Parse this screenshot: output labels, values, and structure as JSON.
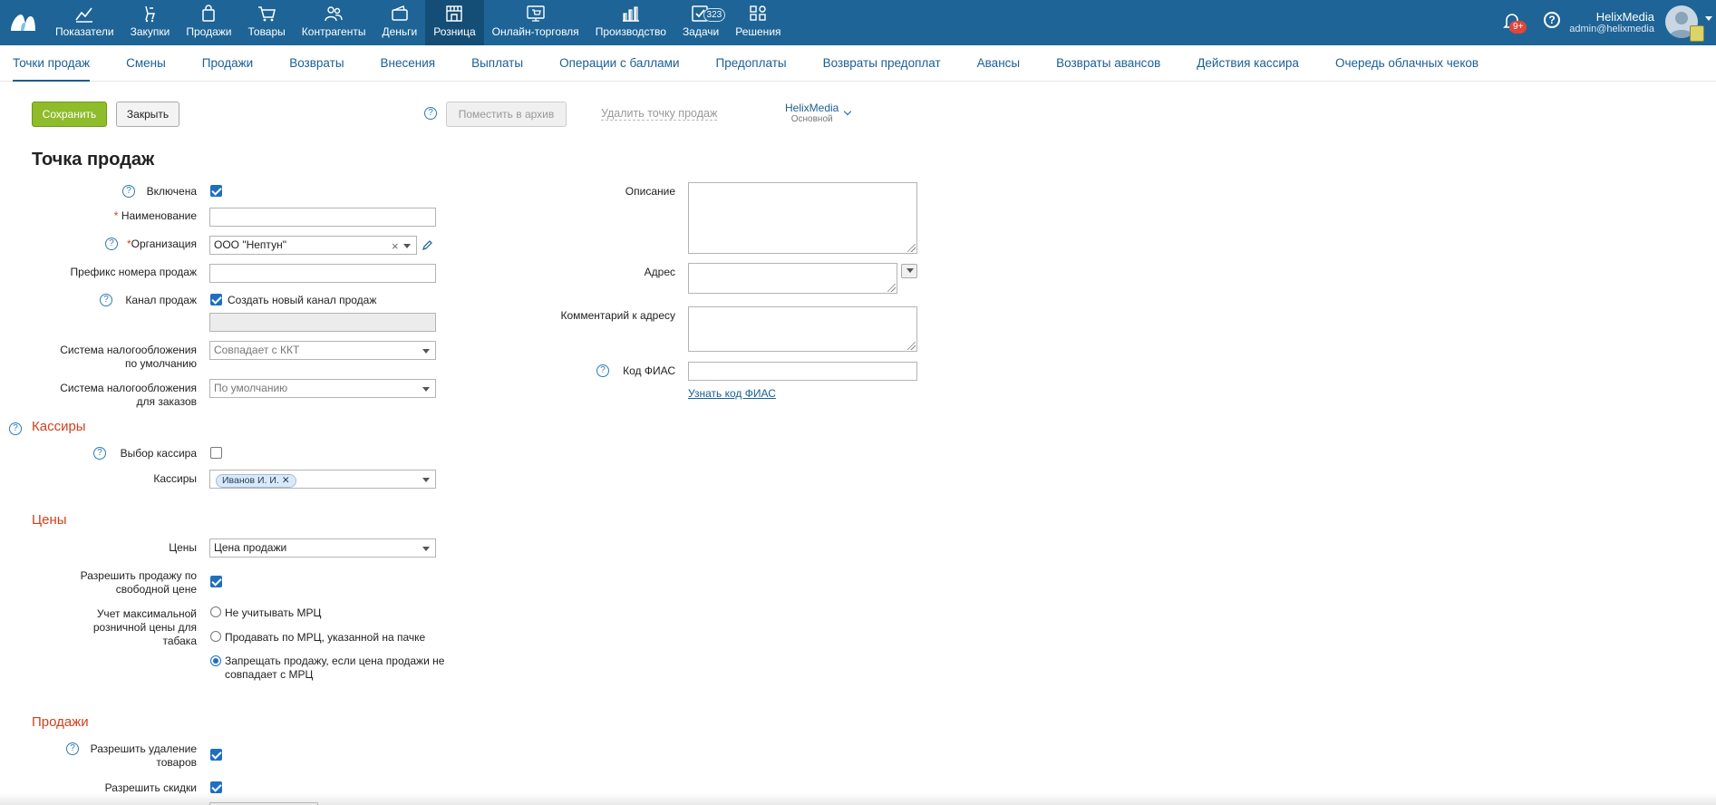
{
  "topnav": {
    "items": [
      {
        "label": "Показатели",
        "icon": "chart-line-icon"
      },
      {
        "label": "Закупки",
        "icon": "purchases-icon"
      },
      {
        "label": "Продажи",
        "icon": "shopping-bag-icon"
      },
      {
        "label": "Товары",
        "icon": "cart-icon"
      },
      {
        "label": "Контрагенты",
        "icon": "people-icon"
      },
      {
        "label": "Деньги",
        "icon": "wallet-icon"
      },
      {
        "label": "Розница",
        "icon": "store-icon"
      },
      {
        "label": "Онлайн-торговля",
        "icon": "online-store-icon"
      },
      {
        "label": "Производство",
        "icon": "production-icon"
      },
      {
        "label": "Задачи",
        "icon": "tasks-icon",
        "badge": "323"
      },
      {
        "label": "Решения",
        "icon": "apps-icon"
      }
    ],
    "active_index": 6
  },
  "user": {
    "name": "HelixMedia",
    "email": "admin@helixmedia",
    "notifications_badge": "9+",
    "help_glyph": "?"
  },
  "subnav": {
    "items": [
      "Точки продаж",
      "Смены",
      "Продажи",
      "Возвраты",
      "Внесения",
      "Выплаты",
      "Операции с баллами",
      "Предоплаты",
      "Возвраты предоплат",
      "Авансы",
      "Возвраты авансов",
      "Действия кассира",
      "Очередь облачных чеков"
    ],
    "active_index": 0
  },
  "toolbar": {
    "save": "Сохранить",
    "close": "Закрыть",
    "archive": "Поместить в архив",
    "delete": "Удалить точку продаж",
    "org_name": "HelixMedia",
    "org_sub": "Основной"
  },
  "form": {
    "title": "Точка продаж",
    "help_glyph": "?",
    "required_mark": "*",
    "enabled_label": "Включена",
    "enabled": true,
    "name_label": "Наименование",
    "name_value": "",
    "org_label": "Организация",
    "org_value": "ООО \"Нептун\"",
    "org_clear": "×",
    "prefix_label": "Префикс номера продаж",
    "prefix_value": "",
    "channel_label": "Канал продаж",
    "channel_new_label": "Создать новый канал продаж",
    "channel_new_checked": true,
    "tax_default_label_1": "Система налогообложения",
    "tax_default_label_2": "по умолчанию",
    "tax_default_value": "Совпадает с ККТ",
    "tax_orders_label_1": "Система налогообложения",
    "tax_orders_label_2": "для заказов",
    "tax_orders_value": "По умолчанию",
    "description_label": "Описание",
    "address_label": "Адрес",
    "address_comment_label": "Комментарий к адресу",
    "fias_label": "Код ФИАС",
    "fias_link": "Узнать код ФИАС"
  },
  "cashiers": {
    "section": "Кассиры",
    "choose_label": "Выбор кассира",
    "choose_checked": false,
    "list_label": "Кассиры",
    "tag": "Иванов И. И.",
    "tag_remove": "✕"
  },
  "prices": {
    "section": "Цены",
    "prices_label": "Цены",
    "prices_value": "Цена продажи",
    "free_price_label_1": "Разрешить продажу по",
    "free_price_label_2": "свободной цене",
    "free_price_checked": true,
    "mrc_label_1": "Учет максимальной",
    "mrc_label_2": "розничной цены для",
    "mrc_label_3": "табака",
    "mrc_options": [
      "Не учитывать МРЦ",
      "Продавать по МРЦ, указанной на пачке",
      "Запрещать продажу, если цена продажи не"
    ],
    "mrc_option3_line2": "совпадает с МРЦ",
    "mrc_selected": 2
  },
  "sales": {
    "section": "Продажи",
    "allow_delete_label_1": "Разрешить удаление",
    "allow_delete_label_2": "товаров",
    "allow_delete_checked": true,
    "allow_discounts_label": "Разрешить скидки",
    "allow_discounts_checked": true
  },
  "colors": {
    "topbar": "#1e6496",
    "active_tab": "#144d75",
    "link": "#1a5f92",
    "section": "#d13f1c",
    "save_button": "#8fbc2a",
    "checkbox": "#1f6fc0"
  }
}
